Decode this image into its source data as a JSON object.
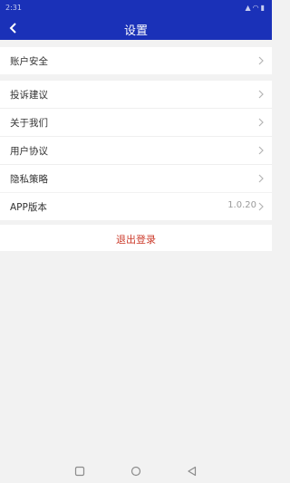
{
  "status_bar": {
    "time": "2:31",
    "icons": "signal wifi battery"
  },
  "header": {
    "title": "设置"
  },
  "groups": [
    {
      "items": [
        {
          "label": "账户安全"
        }
      ]
    },
    {
      "items": [
        {
          "label": "投诉建议"
        },
        {
          "label": "关于我们"
        },
        {
          "label": "用户协议"
        },
        {
          "label": "隐私策略"
        }
      ]
    },
    {
      "items": [
        {
          "label": "APP版本",
          "value": "1.0.20"
        }
      ]
    }
  ],
  "logout_label": "退出登录",
  "colors": {
    "header_bg": "#1a31b8",
    "logout_text": "#cc3b2b",
    "page_bg": "#f2f2f2"
  }
}
